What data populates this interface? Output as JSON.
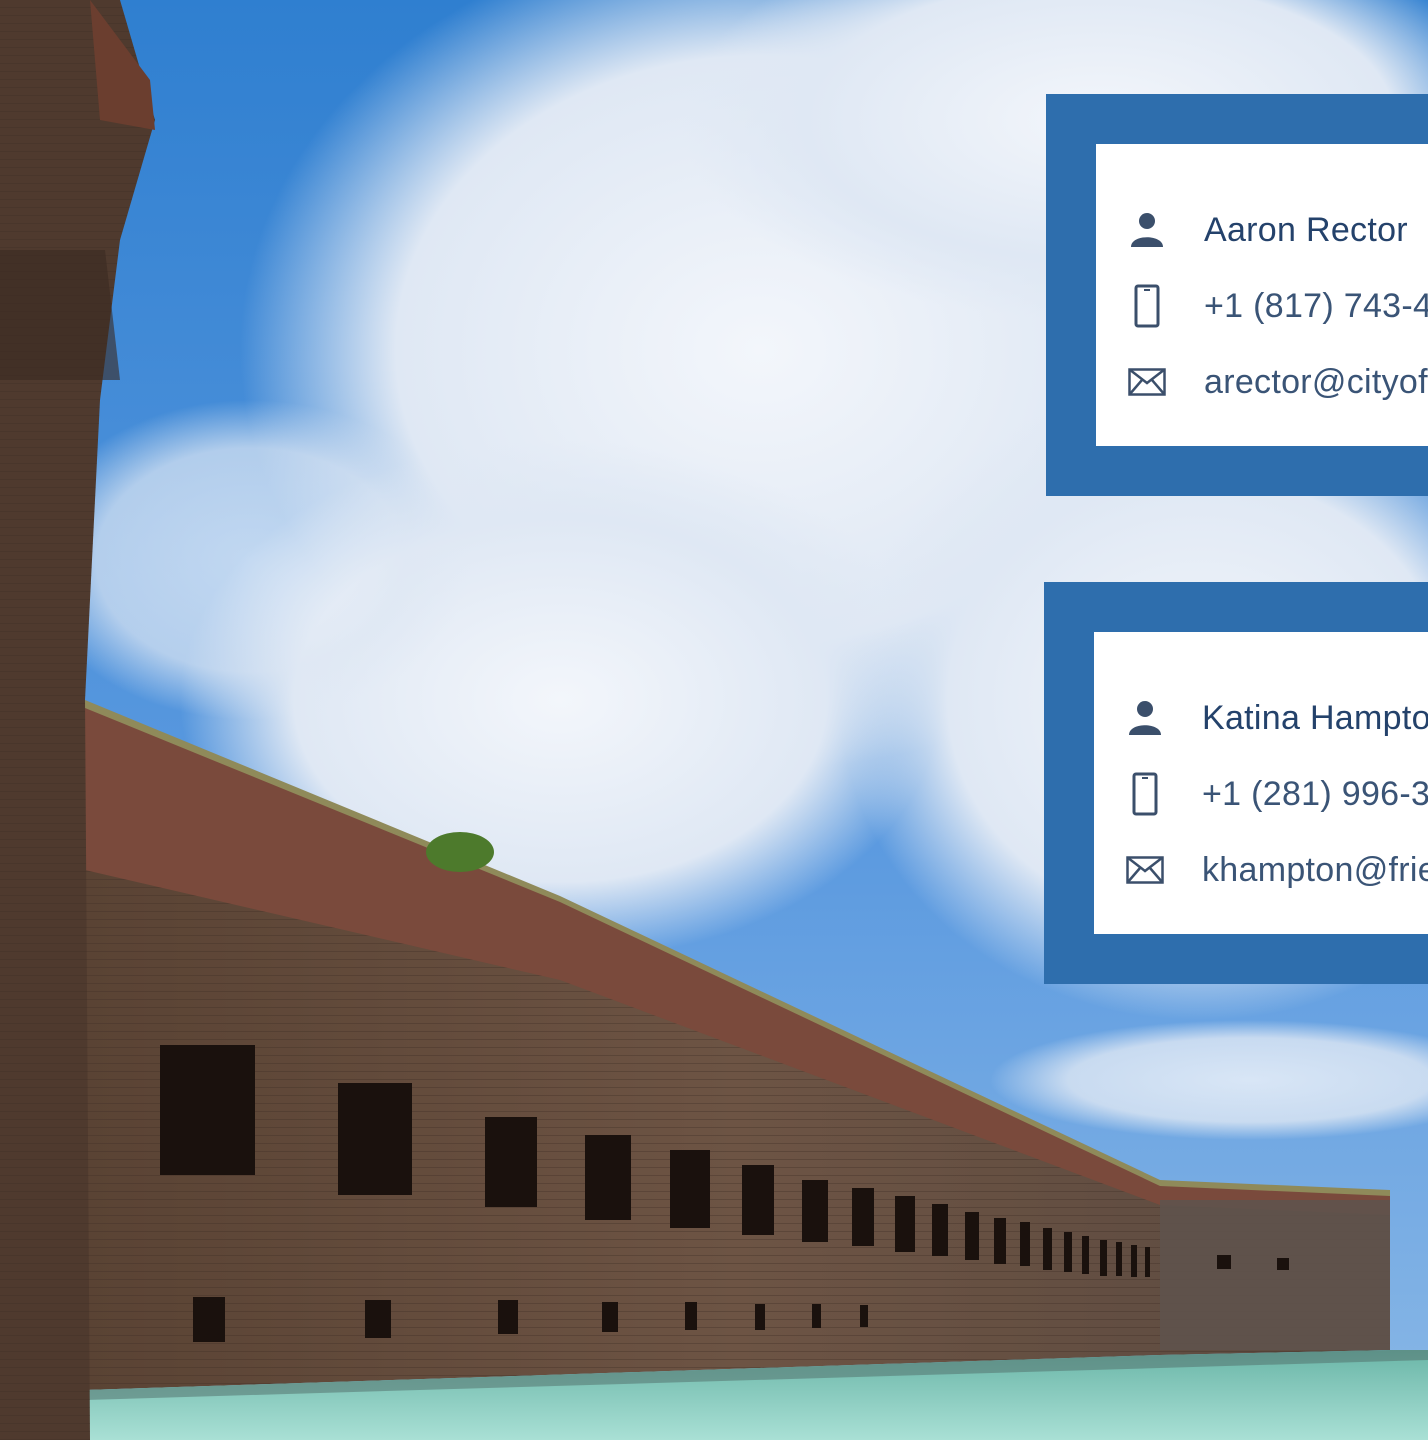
{
  "background": {
    "description_icon": "fort-brick-wall-photo",
    "colors": {
      "sky": "#3f86d3",
      "cloud": "#e6eef8",
      "brick": "#6e5443",
      "water": "#8fd1c6"
    }
  },
  "accent_color": "#2e6ead",
  "contacts": [
    {
      "name": "Aaron Rector",
      "phone": "+1 (817) 743-4",
      "email": "arector@cityof"
    },
    {
      "name": "Katina Hampton",
      "phone": "+1 (281) 996-3",
      "email": "khampton@frie"
    }
  ],
  "icons": {
    "person": "person-icon",
    "phone": "phone-icon",
    "mail": "mail-icon"
  }
}
